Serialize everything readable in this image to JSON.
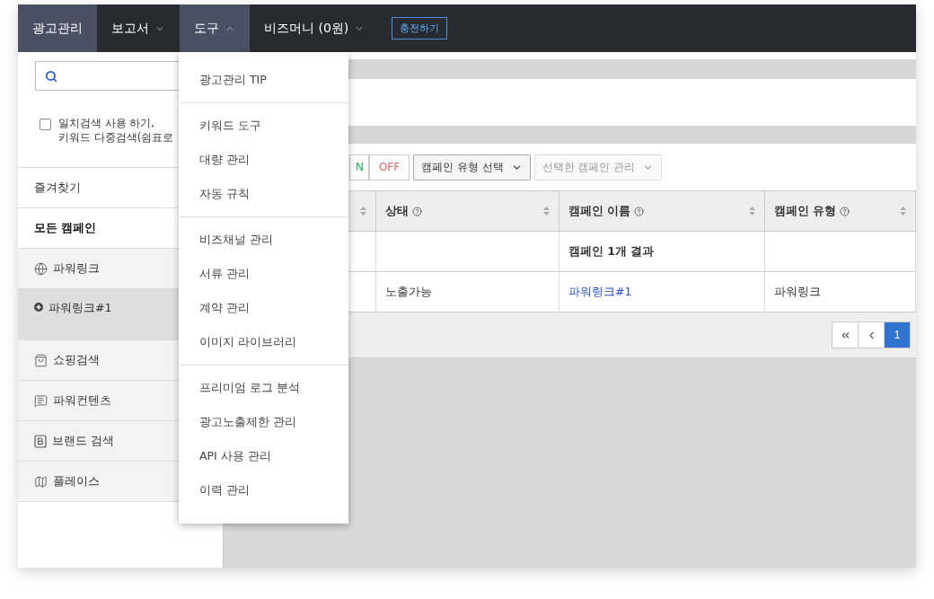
{
  "nav": {
    "items": [
      {
        "label": "광고관리",
        "selected": true,
        "kind": "plain"
      },
      {
        "label": "보고서",
        "selected": false,
        "kind": "menu",
        "expanded": false
      },
      {
        "label": "도구",
        "selected": true,
        "kind": "menu",
        "expanded": true
      },
      {
        "label": "비즈머니 (0원)",
        "selected": false,
        "kind": "menu",
        "expanded": false
      }
    ],
    "charge_button": "충전하기"
  },
  "tools_menu": {
    "groups": [
      [
        "광고관리 TIP"
      ],
      [
        "키워드 도구",
        "대량 관리",
        "자동 규칙"
      ],
      [
        "비즈채널 관리",
        "서류 관리",
        "계약 관리",
        "이미지 라이브러리"
      ],
      [
        "프리미엄 로그 분석",
        "광고노출제한 관리",
        "API 사용 관리",
        "이력 관리"
      ]
    ]
  },
  "sidebar": {
    "exact_search": {
      "checked": false,
      "lines": [
        "일치검색 사용 하기,",
        "키워드 다중검색(쉼표로"
      ]
    },
    "items": [
      {
        "label": "즐겨찾기",
        "kind": "plain",
        "selected": false
      },
      {
        "label": "모든 캠페인",
        "kind": "heading",
        "selected": false
      },
      {
        "label": "파워링크",
        "kind": "globe",
        "selected": false
      },
      {
        "label": "파워링크#1",
        "kind": "campaign",
        "selected": true
      },
      {
        "label": "쇼핑검색",
        "kind": "bag",
        "selected": false
      },
      {
        "label": "파워컨텐츠",
        "kind": "chat",
        "selected": false
      },
      {
        "label": "브랜드 검색",
        "kind": "brand",
        "selected": false
      },
      {
        "label": "플레이스",
        "kind": "map",
        "selected": false
      }
    ]
  },
  "toolbar": {
    "on": "N",
    "off": "OFF",
    "type_select": "캠페인 유형 선택",
    "manage_select": "선택한 캠페인 관리"
  },
  "table": {
    "columns": [
      {
        "label": "상태"
      },
      {
        "label": "캠페인 이름"
      },
      {
        "label": "캠페인 유형"
      }
    ],
    "summary": "캠페인 1개 결과",
    "rows": [
      {
        "status": "노출가능",
        "name": "파워링크#1",
        "type": "파워링크"
      }
    ]
  },
  "pagination": {
    "pages": [
      {
        "label": "1",
        "selected": true
      }
    ]
  }
}
